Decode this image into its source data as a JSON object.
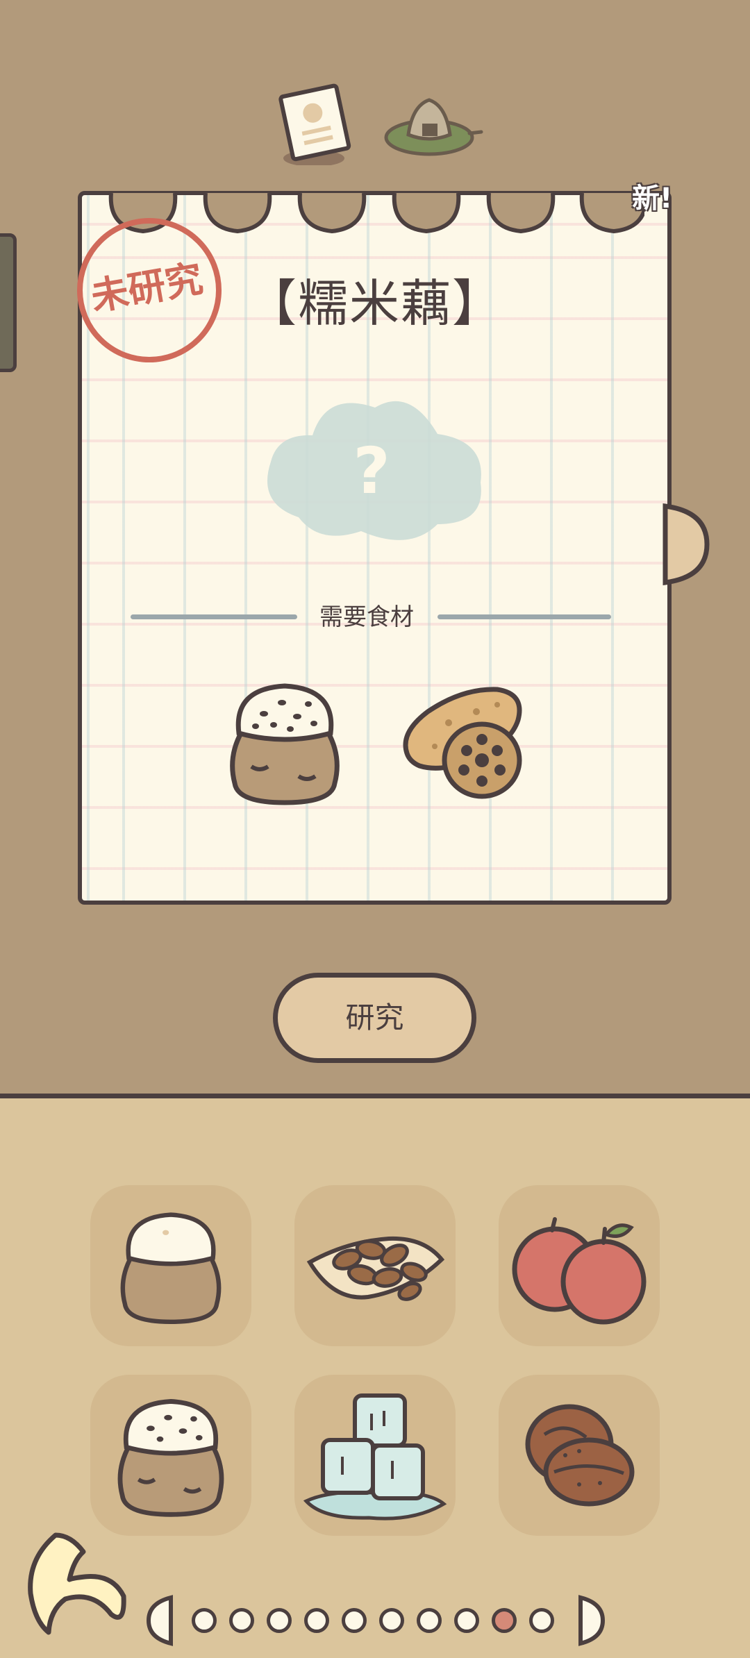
{
  "recipe": {
    "title": "【糯米藕】",
    "status_stamp": "未研究",
    "new_badge": "新!",
    "ingredients_label": "需要食材",
    "ingredients": [
      "glutinous-rice-sack-icon",
      "lotus-root-icon"
    ],
    "mystery_symbol": "?"
  },
  "tabs": [
    "recipe-card-tab-icon",
    "rice-ball-tab-icon"
  ],
  "research_button": {
    "label": "研究"
  },
  "inventory": {
    "items": [
      "flour-sack-icon",
      "almonds-icon",
      "apples-icon",
      "glutinous-rice-sack-icon",
      "ice-cubes-icon",
      "walnuts-icon"
    ]
  },
  "pager": {
    "total_pages": 10,
    "current_page": 9
  },
  "colors": {
    "outline": "#4b3f3f",
    "top_background": "#b29a7b",
    "bottom_background": "#dbc59c",
    "paper": "#fdf8e8",
    "stamp_red": "#d06a5a",
    "button": "#e3caa5",
    "tile": "#d3b98f",
    "active_dot": "#d58a78"
  }
}
